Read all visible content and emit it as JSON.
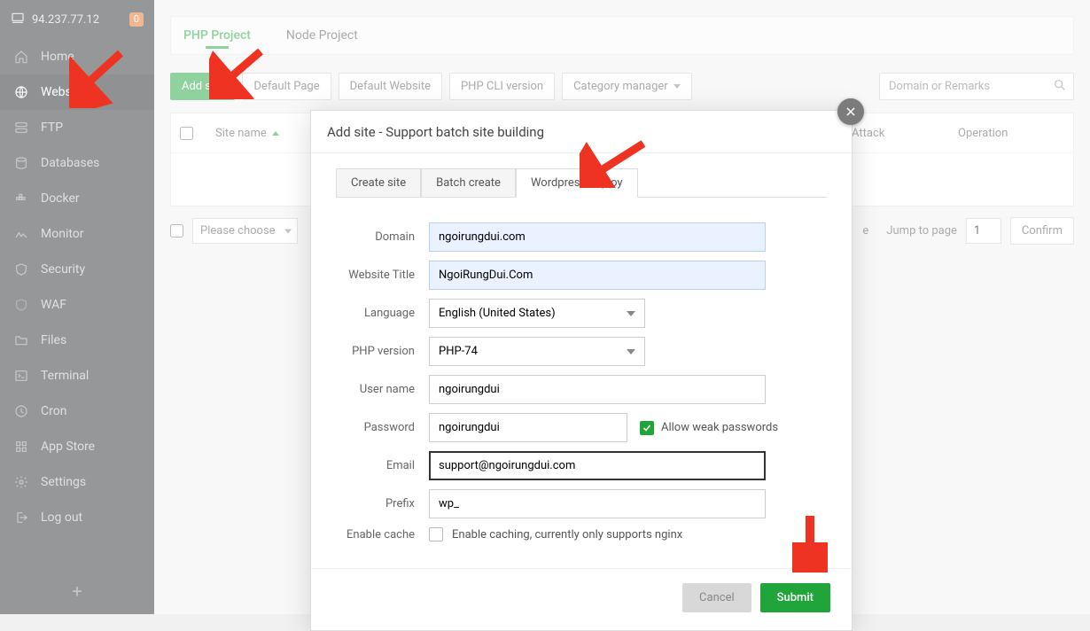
{
  "sidebarTop": {
    "ip": "94.237.77.12",
    "badge": "0"
  },
  "nav": {
    "home": "Home",
    "website": "Website",
    "ftp": "FTP",
    "databases": "Databases",
    "docker": "Docker",
    "monitor": "Monitor",
    "security": "Security",
    "waf": "WAF",
    "files": "Files",
    "terminal": "Terminal",
    "cron": "Cron",
    "appstore": "App Store",
    "settings": "Settings",
    "logout": "Log out"
  },
  "tabs": {
    "php": "PHP Project",
    "node": "Node Project"
  },
  "toolbar": {
    "addsite": "Add site",
    "defaultpage": "Default Page",
    "defaultwebsite": "Default Website",
    "phpcli": "PHP CLI version",
    "category": "Category manager"
  },
  "search": {
    "placeholder": "Domain or Remarks"
  },
  "table": {
    "siteName": "Site name",
    "attack": "Attack",
    "operation": "Operation"
  },
  "pager": {
    "please": "Please choose",
    "eSuffix": "e",
    "eTri": true,
    "jump": "Jump to page",
    "page": "1",
    "confirm": "Confirm"
  },
  "modal": {
    "title": "Add site - Support batch site building",
    "tabs": {
      "create": "Create site",
      "batch": "Batch create",
      "wp": "Wordpress deploy"
    },
    "labels": {
      "domain": "Domain",
      "title": "Website Title",
      "language": "Language",
      "php": "PHP version",
      "user": "User name",
      "password": "Password",
      "allowweak": "Allow weak passwords",
      "email": "Email",
      "prefix": "Prefix",
      "enablecache": "Enable cache",
      "cachehint": "Enable caching, currently only supports nginx"
    },
    "values": {
      "domain": "ngoirungdui.com",
      "title": "NgoiRungDui.Com",
      "language": "English (United States)",
      "php": "PHP-74",
      "user": "ngoirungdui",
      "password": "ngoirungdui",
      "email": "support@ngoirungdui.com",
      "prefix": "wp_"
    },
    "footer": {
      "cancel": "Cancel",
      "submit": "Submit"
    }
  }
}
